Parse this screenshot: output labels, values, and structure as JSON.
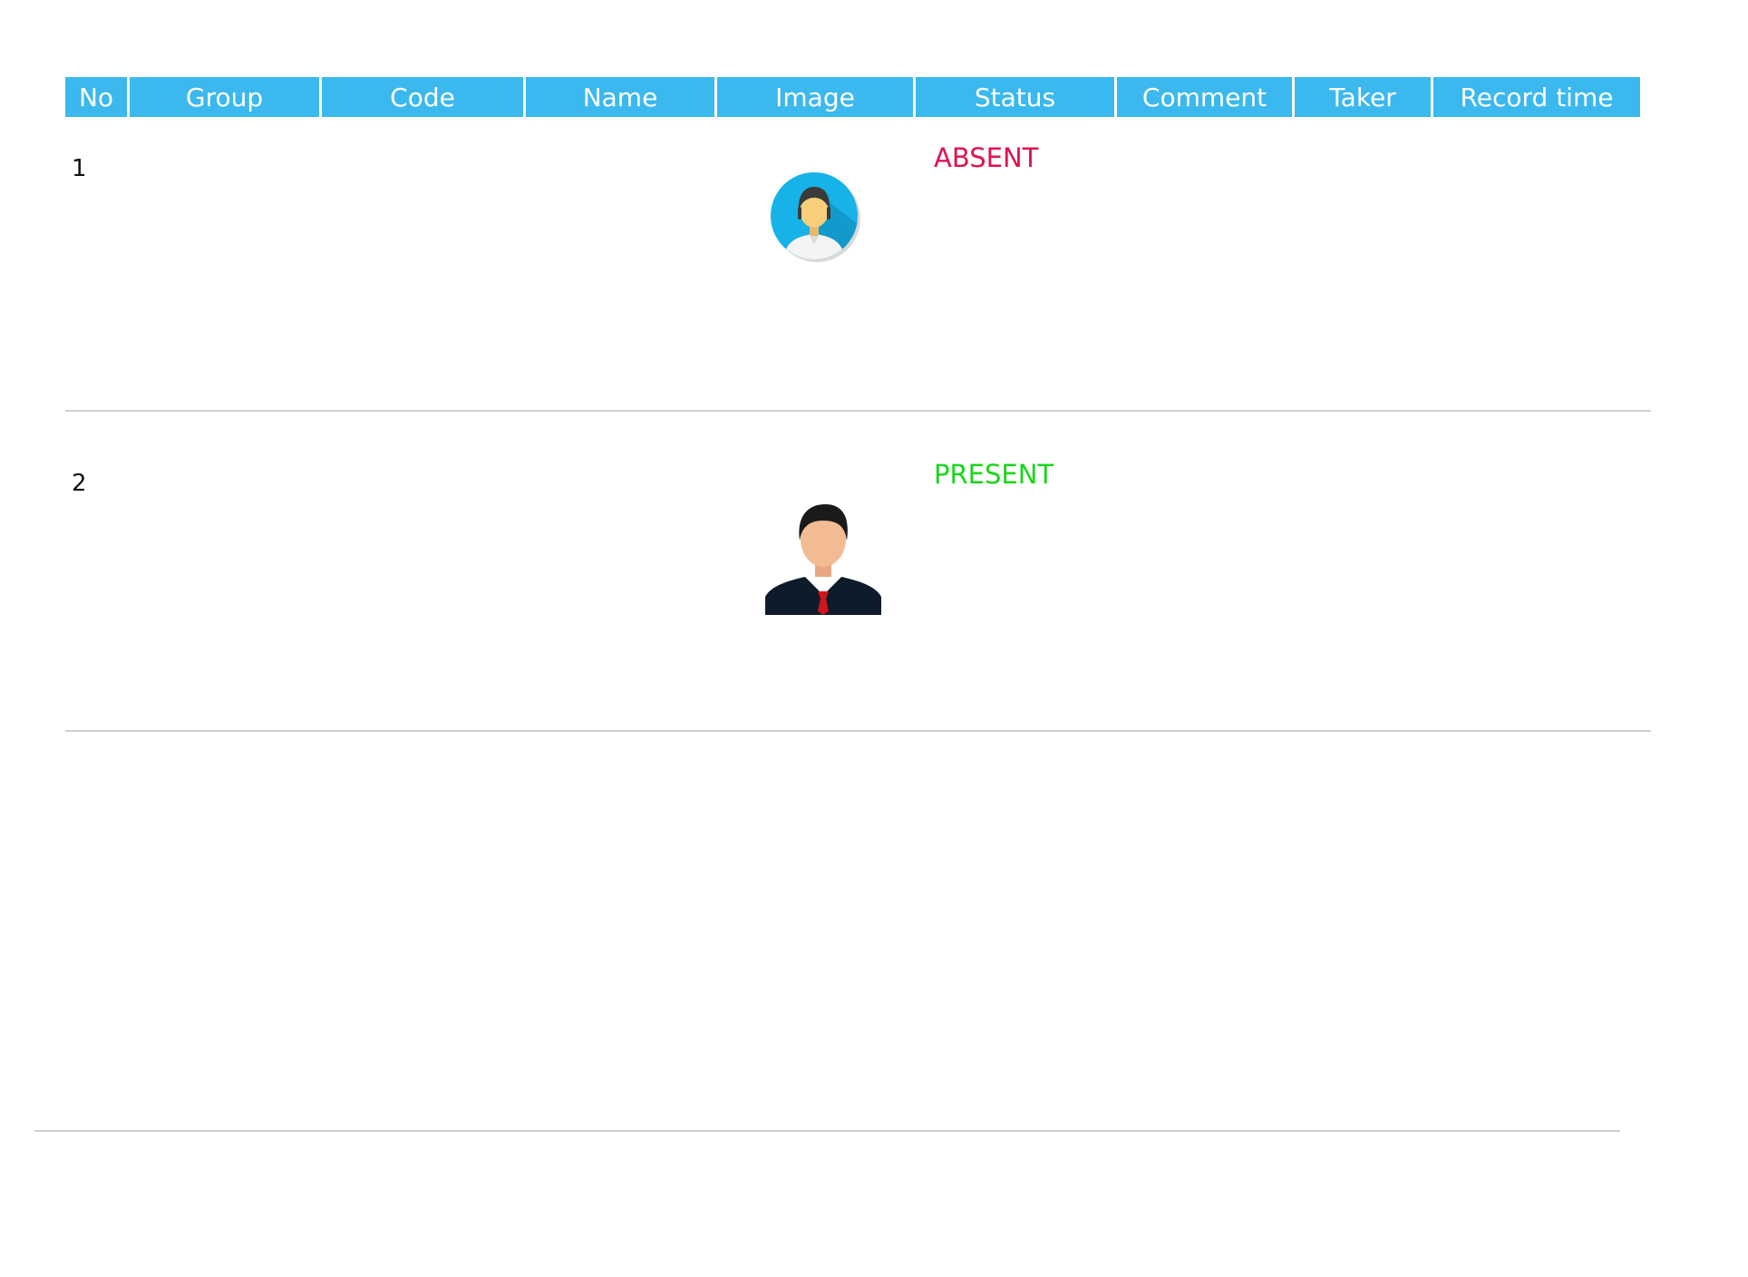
{
  "table": {
    "columns": [
      "No",
      "Group",
      "Code",
      "Name",
      "Image",
      "Status",
      "Comment",
      "Taker",
      "Record time"
    ],
    "rows": [
      {
        "no": "1",
        "status": "ABSENT",
        "status_color": "#e0124f",
        "avatar": "female-avatar-icon"
      },
      {
        "no": "2",
        "status": "PRESENT",
        "status_color": "#18d61a",
        "avatar": "male-avatar-icon"
      }
    ]
  },
  "colors": {
    "header_bg": "#3bb8ee",
    "header_text": "#ffffff"
  }
}
